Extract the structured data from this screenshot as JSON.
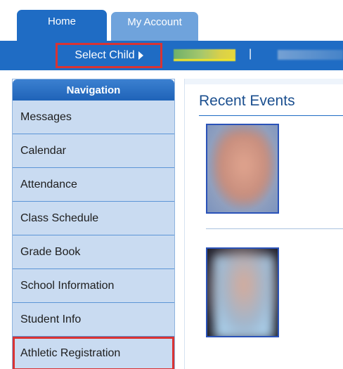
{
  "tabs": [
    {
      "label": "Home",
      "active": true
    },
    {
      "label": "My Account",
      "active": false
    }
  ],
  "subbar": {
    "select_child_label": "Select Child",
    "separator": "|"
  },
  "navigation": {
    "title": "Navigation",
    "items": [
      {
        "label": "Messages"
      },
      {
        "label": "Calendar"
      },
      {
        "label": "Attendance"
      },
      {
        "label": "Class Schedule"
      },
      {
        "label": "Grade Book"
      },
      {
        "label": "School Information"
      },
      {
        "label": "Student Info"
      },
      {
        "label": "Athletic Registration",
        "highlighted": true
      }
    ]
  },
  "main": {
    "title": "Recent Events"
  },
  "colors": {
    "primary_blue": "#1f6cc4",
    "tab_inactive": "#6fa3dc",
    "nav_item_bg": "#c9dbf1",
    "highlight_red": "#d93333"
  },
  "icons": {
    "select_child_caret": "caret-right-icon"
  }
}
